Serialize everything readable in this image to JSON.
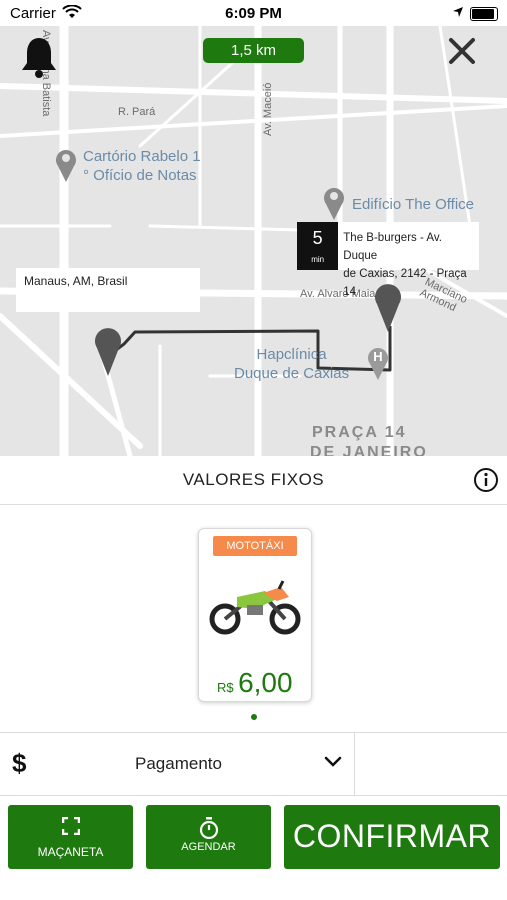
{
  "status_bar": {
    "carrier": "Carrier",
    "time": "6:09 PM"
  },
  "map": {
    "distance": "1,5 km",
    "roads": [
      "Av. Dalma Batista",
      "R. Pará",
      "Av. Maceió",
      "Av. Alvaro Maia",
      "Marciano Armond"
    ],
    "pois": [
      {
        "name": "Cartório Rabelo 1",
        "sub": "° Ofício de Notas"
      },
      {
        "name": "Edifício The Office",
        "sub": ""
      },
      {
        "name": "Hapclínica",
        "sub": "Duque de Caxias"
      }
    ],
    "area": [
      "PRAÇA 14",
      "DE JANEIRO"
    ],
    "origin": "Manaus, AM, Brasil",
    "destination": {
      "eta_value": "5",
      "eta_unit": "min",
      "address_line1": "The B-burgers - Av. Duque",
      "address_line2": "de Caxias, 2142 - Praça 14"
    },
    "route_color": "#333333"
  },
  "section": {
    "title": "VALORES FIXOS"
  },
  "vehicles": [
    {
      "tag": "MOTOTÁXI",
      "currency": "R$",
      "price": "6,00"
    }
  ],
  "payment": {
    "label": "Pagamento"
  },
  "actions": {
    "macaneta": "MAÇANETA",
    "agendar": "AGENDAR",
    "confirmar": "CONFIRMAR"
  },
  "colors": {
    "primary": "#1e7a0f",
    "tag": "#f58a4a"
  }
}
